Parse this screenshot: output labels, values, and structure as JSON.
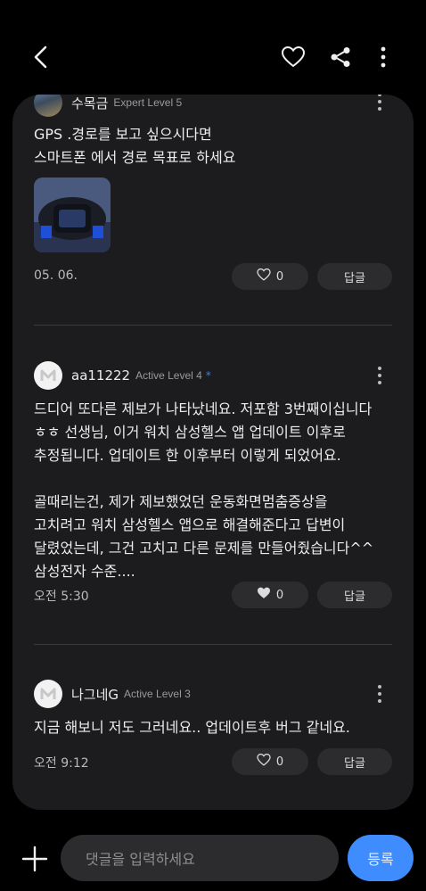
{
  "toolbar": {
    "back": "back",
    "favorite": "favorite",
    "share": "share",
    "more": "more"
  },
  "comments": [
    {
      "username": "수목금",
      "level": "Expert Level 5",
      "text": "GPS .경로를 보고 싶으시다면\n스마트폰 에서 경로 목표로 하세요",
      "date": "05. 06.",
      "likes": "0",
      "reply": "답글"
    },
    {
      "username": "aa11222",
      "level": "Active Level 4",
      "star": "*",
      "text": "드디어 또다른 제보가 나타났네요. 저포함 3번째이십니다\nㅎㅎ 선생님, 이거 워치 삼성헬스 앱 업데이트 이후로\n추정됩니다. 업데이트 한 이후부터 이렇게 되었어요.\n\n골때리는건, 제가 제보했었던 운동화면멈춤증상을\n고치려고 워치 삼성헬스 앱으로 해결해준다고 답변이\n달렸었는데, 그건 고치고 다른 문제를 만들어줬습니다^^\n삼성전자 수준....",
      "date": "오전 5:30",
      "likes": "0",
      "reply": "답글"
    },
    {
      "username": "나그네G",
      "level": "Active Level 3",
      "text": "지금 해보니 저도 그러네요.. 업데이트후 버그 같네요.",
      "date": "오전 9:12",
      "likes": "0",
      "reply": "답글"
    }
  ],
  "composer": {
    "placeholder": "댓글을 입력하세요",
    "submit": "등록"
  }
}
